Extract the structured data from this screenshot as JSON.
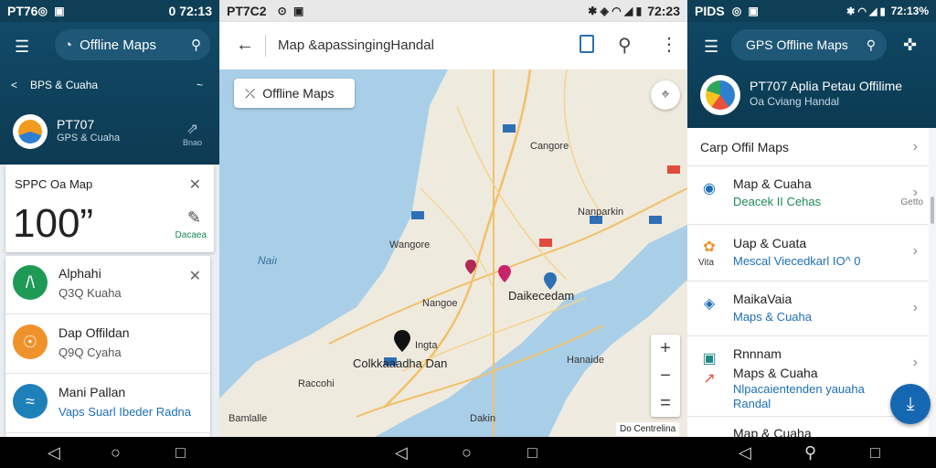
{
  "left": {
    "status": {
      "time": "PT76",
      "battery": "0 72:13"
    },
    "search": {
      "value": "Offline Maps"
    },
    "share_row": {
      "label": "BPS & Cuaha",
      "right": "~"
    },
    "app": {
      "title": "PT707",
      "subtitle": "GPS & Cuaha",
      "pin_label": "Bnao"
    },
    "speed_card": {
      "title": "SPPC Oa Map",
      "value": "100”",
      "badge": "Dacaea"
    },
    "items": [
      {
        "name": "Alphahi",
        "sub": "Q3Q Kuaha",
        "color": "#1f9a55",
        "icon": "/\\"
      },
      {
        "name": "Dap Offildan",
        "sub": "Q9Q Cyaha",
        "color": "#f0922c",
        "icon": "☉"
      },
      {
        "name": "Mani Pallan",
        "sub": "Vaps Suarl Ibeder Radna",
        "color": "#1d80b8",
        "icon": "≈"
      }
    ]
  },
  "middle": {
    "status": {
      "time": "PT7C2",
      "battery": "72:23"
    },
    "toolbar": {
      "title": "Map &apassingingHandal"
    },
    "offline_chip": "Offline Maps",
    "attribution": "Do Centrelina",
    "labels": {
      "sea": "Naiı",
      "cangore": "Cangore",
      "wangore": "Wangore",
      "daikecedan": "Daikecedam",
      "nangoe": "Nangoe",
      "coikkaria": "Colkkaaadha Dan",
      "ingta": "Ingta",
      "hanaide": "Hanaide",
      "raccohi": "Raccohi",
      "bamlalle": "Bamlalle",
      "nanparkin": "Nanparkin",
      "dakin": "Dakin"
    }
  },
  "right": {
    "status": {
      "time": "PIDS",
      "battery": "72:13%"
    },
    "search": {
      "value": "GPS Offline Maps"
    },
    "app": {
      "name": "PT707 Aplia Petau Offilime",
      "sub": "Oa Cviang Handal"
    },
    "section": "Carp Offil Maps",
    "rows": [
      {
        "name": "Map & Cuaha",
        "sub": "Deacek II Cehas",
        "sub_color": "#1b8a54",
        "extra": "Getto"
      },
      {
        "name": "Uap & Cuata",
        "sub": "Mescal Viecedkarl IO^ 0",
        "sub_color": "#1c6fb6",
        "extra": "Vita"
      },
      {
        "name": "MaikaVaia",
        "sub": "Maps & Cuaha",
        "sub_color": "#1c6fb6"
      },
      {
        "name": "Rnnnam",
        "name2": "Maps & Cuaha",
        "sub": "Nlpacaientenden yauaha Randal",
        "sub_color": "#1c6fb6"
      },
      {
        "name": "Map & Cuaha"
      }
    ]
  }
}
